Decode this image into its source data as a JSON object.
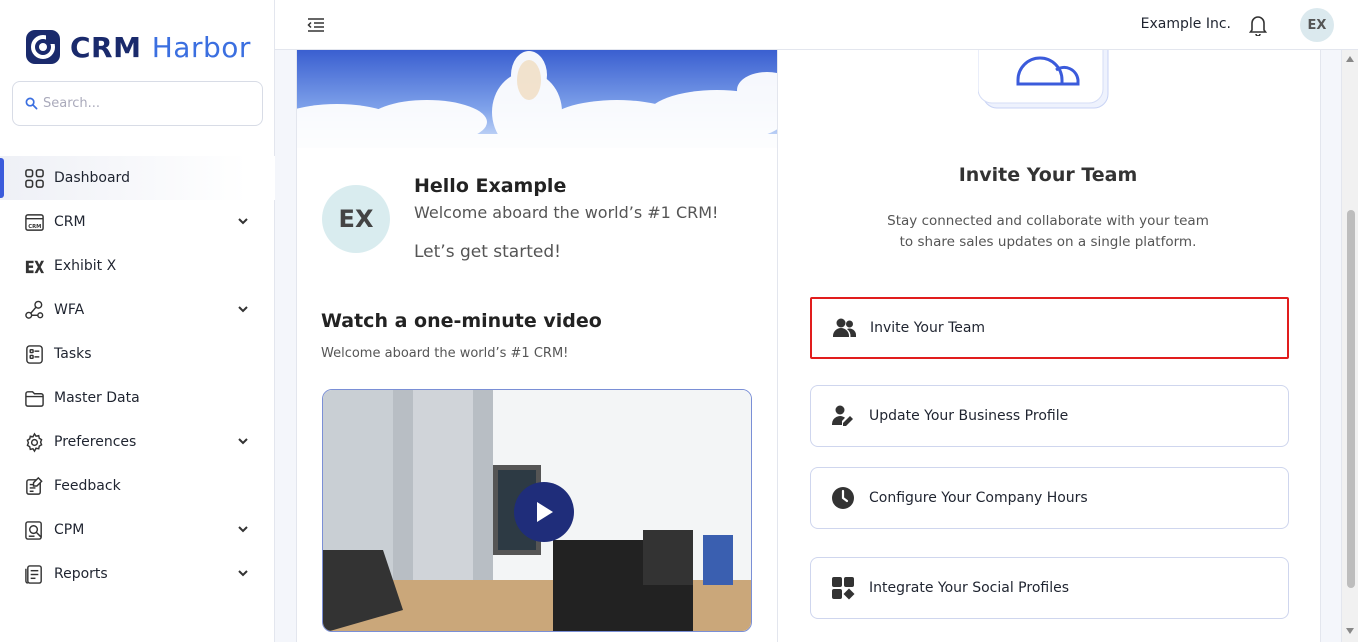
{
  "app": {
    "logo_primary": "CRM",
    "logo_secondary": "Harbor"
  },
  "search": {
    "placeholder": "Search..."
  },
  "sidebar": {
    "items": [
      {
        "label": "Dashboard",
        "icon": "grid-icon",
        "active": true,
        "expandable": false
      },
      {
        "label": "CRM",
        "icon": "crm-window-icon",
        "expandable": true
      },
      {
        "label": "Exhibit X",
        "icon": "exhibit-x-icon",
        "expandable": false
      },
      {
        "label": "WFA",
        "icon": "workflow-icon",
        "expandable": true
      },
      {
        "label": "Tasks",
        "icon": "checklist-icon",
        "expandable": false
      },
      {
        "label": "Master Data",
        "icon": "folder-icon",
        "expandable": false
      },
      {
        "label": "Preferences",
        "icon": "gear-icon",
        "expandable": true
      },
      {
        "label": "Feedback",
        "icon": "feedback-icon",
        "expandable": false
      },
      {
        "label": "CPM",
        "icon": "cpm-search-icon",
        "expandable": true
      },
      {
        "label": "Reports",
        "icon": "report-icon",
        "expandable": true
      }
    ]
  },
  "topbar": {
    "company": "Example Inc.",
    "avatar_initials": "EX"
  },
  "welcome": {
    "avatar_initials": "EX",
    "greeting": "Hello Example",
    "message": "Welcome aboard the world’s #1 CRM!",
    "cta": "Let’s get started!"
  },
  "video": {
    "title": "Watch a one-minute video",
    "subtitle": "Welcome aboard the world’s #1 CRM!"
  },
  "invite": {
    "title": "Invite Your Team",
    "description_line1": "Stay connected and collaborate with your team",
    "description_line2": "to share sales updates on a single platform.",
    "actions": [
      {
        "label": "Invite Your Team",
        "icon": "users-icon",
        "highlighted": true
      },
      {
        "label": "Update Your Business Profile",
        "icon": "user-edit-icon",
        "highlighted": false
      },
      {
        "label": "Configure Your Company Hours",
        "icon": "clock-icon",
        "highlighted": false
      },
      {
        "label": "Integrate Your Social Profiles",
        "icon": "apps-icon",
        "highlighted": false
      }
    ]
  },
  "colors": {
    "brand_dark": "#1a2a6c",
    "brand_accent": "#3b6fe0",
    "active_indicator": "#3b5bdb",
    "highlight_border": "#e11d1d",
    "play_button": "#1f2d7a"
  }
}
